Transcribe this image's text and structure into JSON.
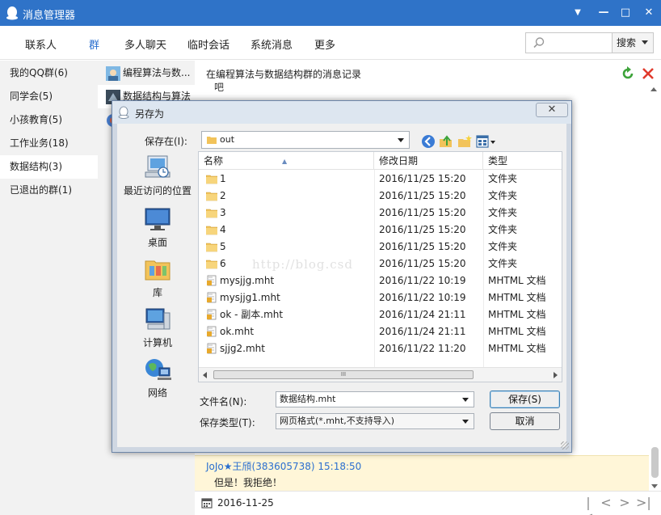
{
  "window": {
    "title": "消息管理器",
    "controls": {
      "minimize": "▼",
      "restore": "—",
      "maximize": "□",
      "close": "✕"
    }
  },
  "toolbar": {
    "tabs": [
      {
        "label": "联系人"
      },
      {
        "label": "群",
        "active": true
      },
      {
        "label": "多人聊天"
      },
      {
        "label": "临时会话"
      },
      {
        "label": "系统消息"
      },
      {
        "label": "更多"
      }
    ],
    "search_value": "",
    "search_button": "搜索"
  },
  "left_nav": {
    "items": [
      {
        "label": "我的QQ群(6)"
      },
      {
        "label": "同学会(5)"
      },
      {
        "label": "小孩教育(5)"
      },
      {
        "label": "工作业务(18)"
      },
      {
        "label": "数据结构(3)",
        "selected": true
      },
      {
        "label": "已退出的群(1)"
      }
    ]
  },
  "groups": {
    "items": [
      {
        "label": "编程算法与数..."
      },
      {
        "label": "数据结构与算法",
        "selected": true
      }
    ]
  },
  "messages": {
    "header": "在编程算法与数据结构群的消息记录",
    "partial_text": "吧",
    "highlight": {
      "sender": "JoJo★王頎(383605738) 15:18:50",
      "body": "但是！我拒绝！"
    },
    "date": "2016-11-25",
    "pager": {
      "first": "|<",
      "prev": "<",
      "next": ">",
      "last": ">|"
    }
  },
  "dialog": {
    "title": "另存为",
    "close_label": "✕",
    "save_in_label": "保存在(I):",
    "save_in_value": "out",
    "places": [
      {
        "label": "最近访问的位置"
      },
      {
        "label": "桌面"
      },
      {
        "label": "库"
      },
      {
        "label": "计算机"
      },
      {
        "label": "网络"
      }
    ],
    "columns": {
      "name": "名称",
      "date": "修改日期",
      "type": "类型"
    },
    "files": [
      {
        "name": "1",
        "date": "2016/11/25 15:20",
        "type": "文件夹",
        "kind": "folder"
      },
      {
        "name": "2",
        "date": "2016/11/25 15:20",
        "type": "文件夹",
        "kind": "folder"
      },
      {
        "name": "3",
        "date": "2016/11/25 15:20",
        "type": "文件夹",
        "kind": "folder"
      },
      {
        "name": "4",
        "date": "2016/11/25 15:20",
        "type": "文件夹",
        "kind": "folder"
      },
      {
        "name": "5",
        "date": "2016/11/25 15:20",
        "type": "文件夹",
        "kind": "folder"
      },
      {
        "name": "6",
        "date": "2016/11/25 15:20",
        "type": "文件夹",
        "kind": "folder"
      },
      {
        "name": "mysjjg.mht",
        "date": "2016/11/22 10:19",
        "type": "MHTML 文档",
        "kind": "mht"
      },
      {
        "name": "mysjjg1.mht",
        "date": "2016/11/22 10:19",
        "type": "MHTML 文档",
        "kind": "mht"
      },
      {
        "name": "ok - 副本.mht",
        "date": "2016/11/24 21:11",
        "type": "MHTML 文档",
        "kind": "mht"
      },
      {
        "name": "ok.mht",
        "date": "2016/11/24 21:11",
        "type": "MHTML 文档",
        "kind": "mht"
      },
      {
        "name": "sjjg2.mht",
        "date": "2016/11/22 11:20",
        "type": "MHTML 文档",
        "kind": "mht"
      }
    ],
    "scroll_grip": "III",
    "filename_label": "文件名(N):",
    "filename_value": "数据结构.mht",
    "filetype_label": "保存类型(T):",
    "filetype_value": "网页格式(*.mht,不支持导入)",
    "save_button": "保存(S)",
    "cancel_button": "取消",
    "watermark": "http://blog.csd"
  },
  "colors": {
    "title_bar": "#2f73c8",
    "accent_blue": "#2a6fcf",
    "highlight_bg": "#fff6d8",
    "folder": "#f2c35a"
  }
}
